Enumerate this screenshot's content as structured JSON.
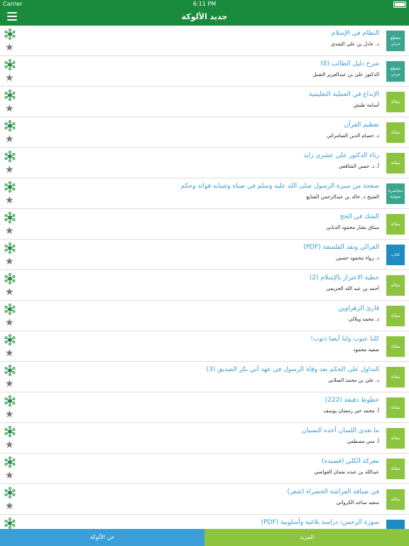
{
  "status": {
    "carrier": "Carrier",
    "time": "6:11 PM"
  },
  "header": {
    "title": "جديد الألوكة"
  },
  "colors": {
    "green": "#1a8a3c",
    "article": "#8dc43f",
    "audio": "#3ca58d",
    "book": "#1e8bc3",
    "link": "#3b9bd8",
    "tab_about": "#3a9ed9",
    "tab_more": "#8dc43f"
  },
  "items": [
    {
      "type": "مقطع مرئي",
      "title": "النظام في الإسلام",
      "author": "د. عادل بن علي الشدي",
      "color": "#3ca58d"
    },
    {
      "type": "مقطع مرئي",
      "title": "شرح دليل الطالب (8)",
      "author": "الدكتور علي بن عبدالعزيز الشبل",
      "color": "#3ca58d"
    },
    {
      "type": "مقالة",
      "title": "الإبداع في العملية التعليمية",
      "author": "أسامة طبش",
      "color": "#8dc43f"
    },
    {
      "type": "مقالة",
      "title": "تعظيم القرآن",
      "author": "د. حسام الدين السامرائي",
      "color": "#8dc43f"
    },
    {
      "type": "مقالة",
      "title": "رثاء الدكتور علي عشري زايد",
      "author": "أ. د. حسن الشافعي",
      "color": "#8dc43f"
    },
    {
      "type": "محاضرة صوتية",
      "title": "صفحة من سيرة الرسول صلى الله عليه وسلم في صباه وشبابه فوائد وحكم",
      "author": "الشيخ د. خالد بن عبدالرحمن الشايع",
      "color": "#3ca58d"
    },
    {
      "type": "مقالة",
      "title": "الشك في الحج",
      "author": "ميثاق بشار محمود الذيابي",
      "color": "#8dc43f"
    },
    {
      "type": "كتاب",
      "title": "الغزالي ونقد الفلسفة (PDF)",
      "author": "د. رواء محمود حسين",
      "color": "#1e8bc3"
    },
    {
      "type": "مقالة",
      "title": "خطبة الاعتزاز بالإسلام (2)",
      "author": "أحمد بن عبد الله الحزيمي",
      "color": "#8dc43f"
    },
    {
      "type": "مقالة",
      "title": "قارئ الزهراوين",
      "author": "د. محمد ويلالي",
      "color": "#8dc43f"
    },
    {
      "type": "مقالة",
      "title": "كلنا عيوب ولنا أيضا ذنوب!",
      "author": "صفية محمود",
      "color": "#8dc43f"
    },
    {
      "type": "مقالة",
      "title": "التداول على الحكم بعد وفاة الرسول في عهد أبي بكر الصديق (3)",
      "author": "د. علي بن محمد الصلابي",
      "color": "#8dc43f"
    },
    {
      "type": "مقالة",
      "title": "خطوط دقيقة (222)",
      "author": "أ. محمد خير رمضان يوسف",
      "color": "#8dc43f"
    },
    {
      "type": "مقالة",
      "title": "ما تعدى اللسان أخذه النسيان",
      "author": "أ. مني مصطفى",
      "color": "#8dc43f"
    },
    {
      "type": "مقالة",
      "title": "معركة الكلي (قصيدة)",
      "author": "عبدالله بن عبده نعمان العواضي",
      "color": "#8dc43f"
    },
    {
      "type": "مقالة",
      "title": "في ضيافة الفراشة الخضراء (شعر)",
      "author": "سعيد ساجد الكرواني",
      "color": "#8dc43f"
    },
    {
      "type": "",
      "title": "سورة الرحمن: دراسة بلاغية وأسلوبية (PDF)",
      "author": "",
      "color": "#1e8bc3"
    }
  ],
  "tabs": {
    "about": "عن الألوكة",
    "more": "المزيد"
  }
}
